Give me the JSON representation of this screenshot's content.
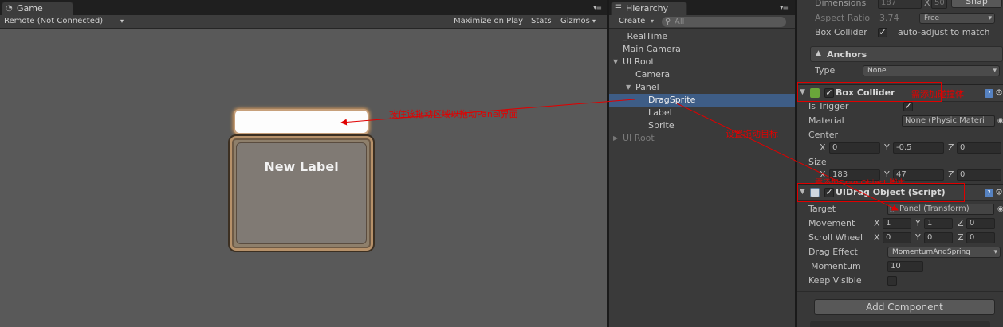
{
  "game": {
    "tab_label": "Game",
    "toolbar": {
      "remote": "Remote (Not Connected)",
      "maximize": "Maximize on Play",
      "stats": "Stats",
      "gizmos": "Gizmos"
    },
    "new_label": "New Label",
    "annotation_drag": "按住该拖动区域以拖动Panel界面"
  },
  "hierarchy": {
    "tab_label": "Hierarchy",
    "create_label": "Create",
    "search_placeholder": "All",
    "items": [
      {
        "label": "_RealTime",
        "depth": 0
      },
      {
        "label": "Main Camera",
        "depth": 0
      },
      {
        "label": "UI Root",
        "depth": 0,
        "expanded": true
      },
      {
        "label": "Camera",
        "depth": 1
      },
      {
        "label": "Panel",
        "depth": 1,
        "expanded": true
      },
      {
        "label": "DragSprite",
        "depth": 2,
        "selected": true
      },
      {
        "label": "Label",
        "depth": 2
      },
      {
        "label": "Sprite",
        "depth": 2
      },
      {
        "label": "UI Root",
        "depth": 0,
        "collapsed": true,
        "dim": true
      }
    ],
    "annotation_target": "设置拖动目标"
  },
  "inspector": {
    "top": {
      "dimensions_label": "Dimensions",
      "dim_x": "187",
      "dim_y": "50",
      "snap_label": "Snap",
      "aspect_label": "Aspect Ratio",
      "aspect_value": "3.74",
      "aspect_mode": "Free",
      "box_collider_label": "Box Collider",
      "auto_adjust_label": "auto-adjust to match"
    },
    "anchors": {
      "title": "Anchors",
      "type_label": "Type",
      "type_value": "None"
    },
    "box_collider": {
      "title": "Box Collider",
      "annotation": "需添加碰撞体",
      "is_trigger_label": "Is Trigger",
      "material_label": "Material",
      "material_value": "None (Physic Materi",
      "center_label": "Center",
      "center": {
        "x": "0",
        "y": "-0.5",
        "z": "0"
      },
      "size_label": "Size",
      "size": {
        "x": "183",
        "y": "47",
        "z": "0"
      }
    },
    "drag_object": {
      "title": "UIDrag Object (Script)",
      "annotation": "需添加Drag Object 脚本",
      "target_label": "Target",
      "target_value": "Panel (Transform)",
      "movement_label": "Movement",
      "movement": {
        "x": "1",
        "y": "1",
        "z": "0"
      },
      "scroll_label": "Scroll Wheel",
      "scroll": {
        "x": "0",
        "y": "0",
        "z": "0"
      },
      "drag_effect_label": "Drag Effect",
      "drag_effect_value": "MomentumAndSpring",
      "momentum_label": "Momentum",
      "momentum_value": "10",
      "keep_visible_label": "Keep Visible"
    },
    "add_component_label": "Add Component",
    "axis": {
      "x": "X",
      "y": "Y",
      "z": "Z"
    },
    "check_mark": "✓"
  }
}
